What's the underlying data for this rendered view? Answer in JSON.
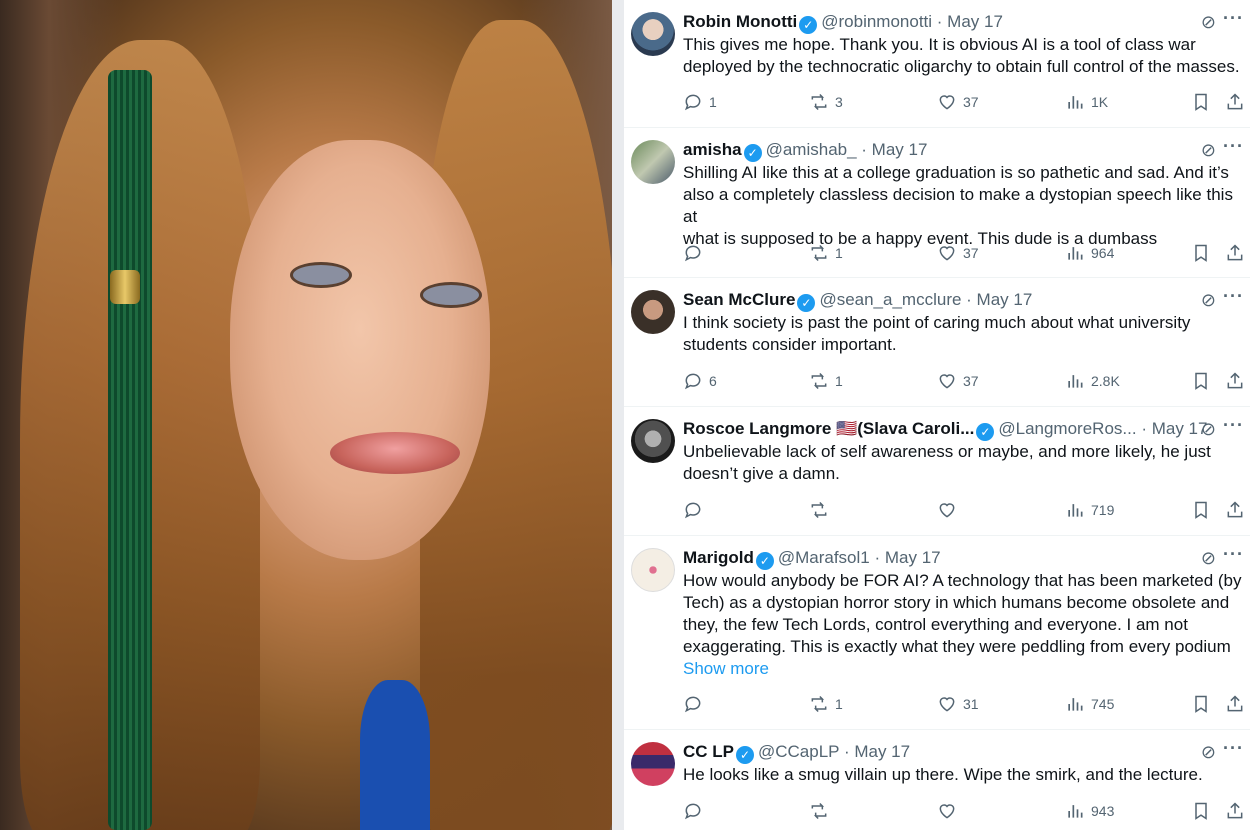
{
  "tweets": [
    {
      "name": "Robin Monotti",
      "handle": "@robinmonotti",
      "date": "· May 17",
      "lines": [
        "This gives me hope. Thank you. It is obvious AI is a tool of class war",
        "deployed by the technocratic oligarchy to obtain full control of the masses."
      ],
      "replies": "1",
      "reposts": "3",
      "likes": "37",
      "views": "1K"
    },
    {
      "name": "amisha",
      "handle": "@amishab_",
      "date": "· May 17",
      "lines": [
        "Shilling AI like this at a college graduation is so pathetic and sad. And it’s",
        "also a completely classless decision to make a dystopian speech like this at",
        "what is supposed to be a happy event. This dude is a dumbass"
      ],
      "replies": "",
      "reposts": "1",
      "likes": "37",
      "views": "964"
    },
    {
      "name": "Sean McClure",
      "handle": "@sean_a_mcclure",
      "date": "· May 17",
      "lines": [
        "I think society is past the point of caring much about what university",
        "students consider important."
      ],
      "replies": "6",
      "reposts": "1",
      "likes": "37",
      "views": "2.8K"
    },
    {
      "name": "Roscoe Langmore 🇺🇸(Slava Caroli...",
      "handle": "@LangmoreRos...",
      "date": "· May 17",
      "lines": [
        "Unbelievable lack of self awareness or maybe, and more likely, he just",
        "doesn’t give a damn."
      ],
      "replies": "",
      "reposts": "",
      "likes": "",
      "views": "719"
    },
    {
      "name": "Marigold",
      "handle": "@Marafsol1",
      "date": "· May 17",
      "lines": [
        "How would anybody be FOR AI? A technology that has been marketed (by",
        "Tech) as a dystopian horror story in which humans become obsolete and",
        "they, the few Tech Lords, control everything and everyone. I am not",
        "exaggerating. This is exactly what they were peddling from every podium"
      ],
      "show_more": "Show more",
      "replies": "",
      "reposts": "1",
      "likes": "31",
      "views": "745"
    },
    {
      "name": "CC LP",
      "handle": "@CCapLP",
      "date": "· May 17",
      "lines": [
        "He looks like a smug villain up there.  Wipe the smirk, and the lecture."
      ],
      "replies": "",
      "reposts": "",
      "likes": "",
      "views": "943"
    }
  ],
  "icons": {
    "verified": "verified-badge-icon",
    "grok": "grok-icon",
    "more": "more-options-icon",
    "reply": "reply-icon",
    "repost": "repost-icon",
    "like": "like-icon",
    "views": "views-icon",
    "bookmark": "bookmark-icon",
    "share": "share-icon"
  },
  "colors": {
    "accent": "#1d9bf0",
    "muted": "#536471"
  }
}
